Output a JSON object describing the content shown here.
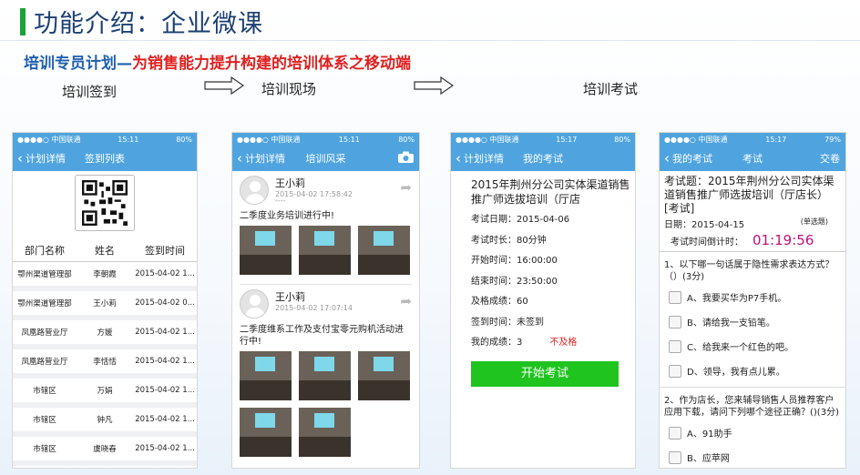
{
  "title": "功能介绍：企业微课",
  "subtitle": {
    "part1": "培训专员计划—",
    "part2": "为销售能力提升构建的培训体系之移动端"
  },
  "steps": [
    "培训签到",
    "培训现场",
    "培训考试"
  ],
  "status_bar": {
    "carrier": "●●●●○ 中国联通",
    "time1": "15:11",
    "battery1": "80%",
    "time3": "15:17",
    "battery3": "80%",
    "battery4": "79%"
  },
  "phone1": {
    "back": "计划详情",
    "title": "签到列表",
    "headers": [
      "部门名称",
      "姓名",
      "签到时间"
    ],
    "rows": [
      [
        "鄂州渠道管理部",
        "李朝霞",
        "2015-04-02 1..."
      ],
      [
        "鄂州渠道管理部",
        "王小莉",
        "2015-04-02 0..."
      ],
      [
        "凤凰路营业厅",
        "方媛",
        "2015-04-02 1..."
      ],
      [
        "凤凰路营业厅",
        "李恬恬",
        "2015-04-02 1..."
      ],
      [
        "市辖区",
        "万娟",
        "2015-04-02 1..."
      ],
      [
        "市辖区",
        "钟凡",
        "2015-04-02 1..."
      ],
      [
        "市辖区",
        "虞晓春",
        "2015-04-02 1..."
      ]
    ]
  },
  "phone2": {
    "back": "计划详情",
    "title": "培训风采",
    "posts": [
      {
        "name": "王小莉",
        "time": "2015-04-02 17:58:42",
        "text": "二季度业务培训进行中!"
      },
      {
        "name": "王小莉",
        "time": "2015-04-02 17:07:14",
        "text": "二季度维系工作及支付宝零元购机活动进行中!"
      }
    ]
  },
  "phone3": {
    "back": "计划详情",
    "title": "我的考试",
    "exam_title": "2015年荆州分公司实体渠道销售推广师选拔培训（厅店",
    "fields": [
      "考试日期：2015-04-06",
      "考试时长：80分钟",
      "开始时间：16:00:00",
      "结束时间：23:50:00",
      "及格成绩：60",
      "签到时间：未签到",
      "我的成绩：3"
    ],
    "fail": "不及格",
    "button": "开始考试"
  },
  "phone4": {
    "back": "我的考试",
    "title": "考试",
    "submit": "交卷",
    "head": "考试题：2015年荆州分公司实体渠道销售推广师选拔培训（厅店长）[考试]",
    "date": "日期：2015-04-15",
    "single": "(单选题)",
    "countdown_label": "考试时间倒计时：",
    "countdown_value": "01:19:56",
    "q1": "1、以下哪一句话属于隐性需求表达方式？（）(3分)",
    "q1_options": [
      "A、我要买华为P7手机。",
      "B、请给我一支铅笔。",
      "C、给我来一个红色的吧。",
      "D、领导，我有点儿累。"
    ],
    "q2": "2、作为店长，您来辅导销售人员推荐客户应用下载，请问下列哪个途径正确？()(3分)",
    "q2_options": [
      "A、91助手",
      "B、应苹网"
    ]
  }
}
